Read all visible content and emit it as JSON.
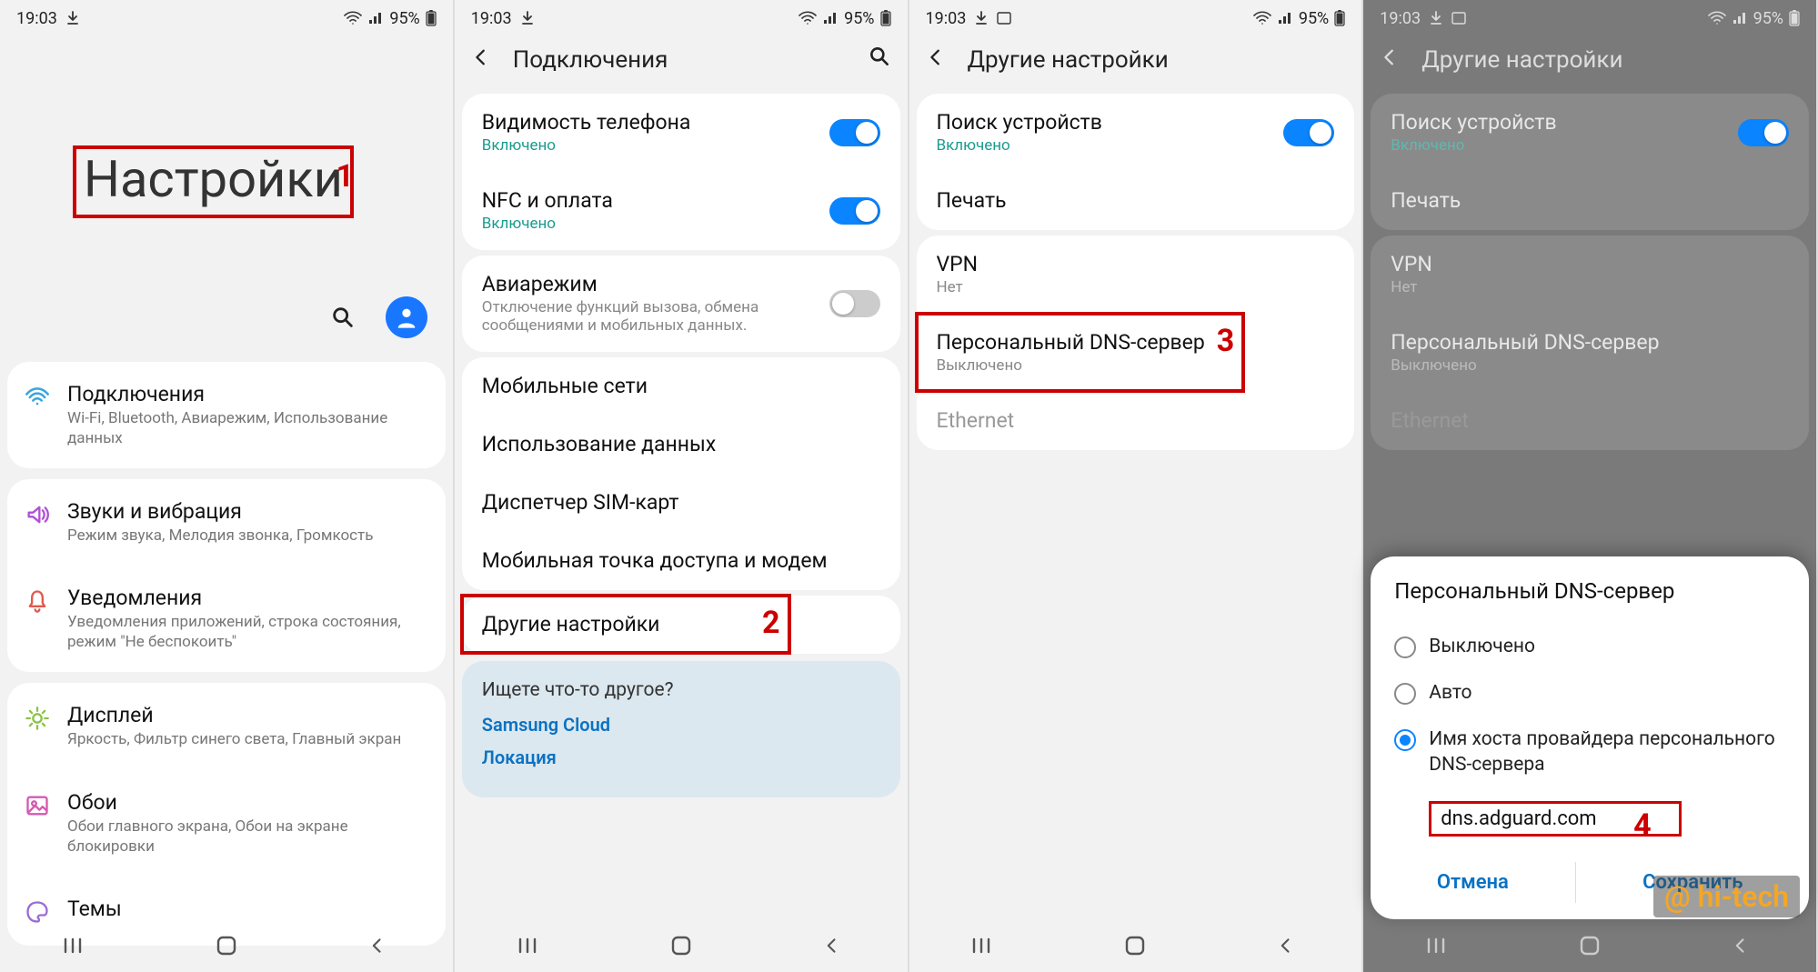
{
  "status": {
    "time": "19:03",
    "battery": "95%"
  },
  "screen1": {
    "title": "Настройки",
    "step": "1",
    "items": [
      {
        "icon": "wifi",
        "color": "#3aa5dd",
        "title": "Подключения",
        "sub": "Wi-Fi, Bluetooth, Авиарежим, Использование данных"
      },
      {
        "icon": "sound",
        "color": "#b150d6",
        "title": "Звуки и вибрация",
        "sub": "Режим звука, Мелодия звонка, Громкость"
      },
      {
        "icon": "bell",
        "color": "#e05a4f",
        "title": "Уведомления",
        "sub": "Уведомления приложений, строка состояния, режим \"Не беспокоить\""
      },
      {
        "icon": "sun",
        "color": "#8bc34a",
        "title": "Дисплей",
        "sub": "Яркость, Фильтр синего света, Главный экран"
      },
      {
        "icon": "image",
        "color": "#d65ab1",
        "title": "Обои",
        "sub": "Обои главного экрана, Обои на экране блокировки"
      },
      {
        "icon": "palette",
        "color": "#9a6cd4",
        "title": "Темы",
        "sub": ""
      }
    ]
  },
  "screen2": {
    "title": "Подключения",
    "step": "2",
    "groups": [
      [
        {
          "title": "Видимость телефона",
          "sub": "Включено",
          "toggle": "on"
        },
        {
          "title": "NFC и оплата",
          "sub": "Включено",
          "toggle": "on"
        }
      ],
      [
        {
          "title": "Авиарежим",
          "sub": "Отключение функций вызова, обмена сообщениями и мобильных данных.",
          "subgray": true,
          "toggle": "off"
        }
      ],
      [
        {
          "title": "Мобильные сети"
        },
        {
          "title": "Использование данных"
        },
        {
          "title": "Диспетчер SIM-карт"
        },
        {
          "title": "Мобильная точка доступа и модем"
        }
      ],
      [
        {
          "title": "Другие настройки"
        }
      ]
    ],
    "help": {
      "title": "Ищете что-то другое?",
      "links": [
        "Samsung Cloud",
        "Локация"
      ]
    }
  },
  "screen3": {
    "title": "Другие настройки",
    "step": "3",
    "groups": [
      [
        {
          "title": "Поиск устройств",
          "sub": "Включено",
          "toggle": "on"
        },
        {
          "title": "Печать"
        }
      ],
      [
        {
          "title": "VPN",
          "sub": "Нет",
          "subgray": true
        },
        {
          "title": "Персональный DNS-сервер",
          "sub": "Выключено",
          "subgray": true
        },
        {
          "title": "Ethernet",
          "disabled": true
        }
      ]
    ]
  },
  "screen4": {
    "title": "Другие настройки",
    "step": "4",
    "groups": [
      [
        {
          "title": "Поиск устройств",
          "sub": "Включено",
          "toggle": "on"
        },
        {
          "title": "Печать"
        }
      ],
      [
        {
          "title": "VPN",
          "sub": "Нет",
          "subgray": true
        },
        {
          "title": "Персональный DNS-сервер",
          "sub": "Выключено",
          "subgray": true
        },
        {
          "title": "Ethernet",
          "disabled": true
        }
      ]
    ],
    "dialog": {
      "title": "Персональный DNS-сервер",
      "opt_off": "Выключено",
      "opt_auto": "Авто",
      "opt_host": "Имя хоста провайдера персонального DNS-сервера",
      "value": "dns.adguard.com",
      "cancel": "Отмена",
      "save": "Сохранить"
    }
  },
  "watermark": "@ hi-tech"
}
